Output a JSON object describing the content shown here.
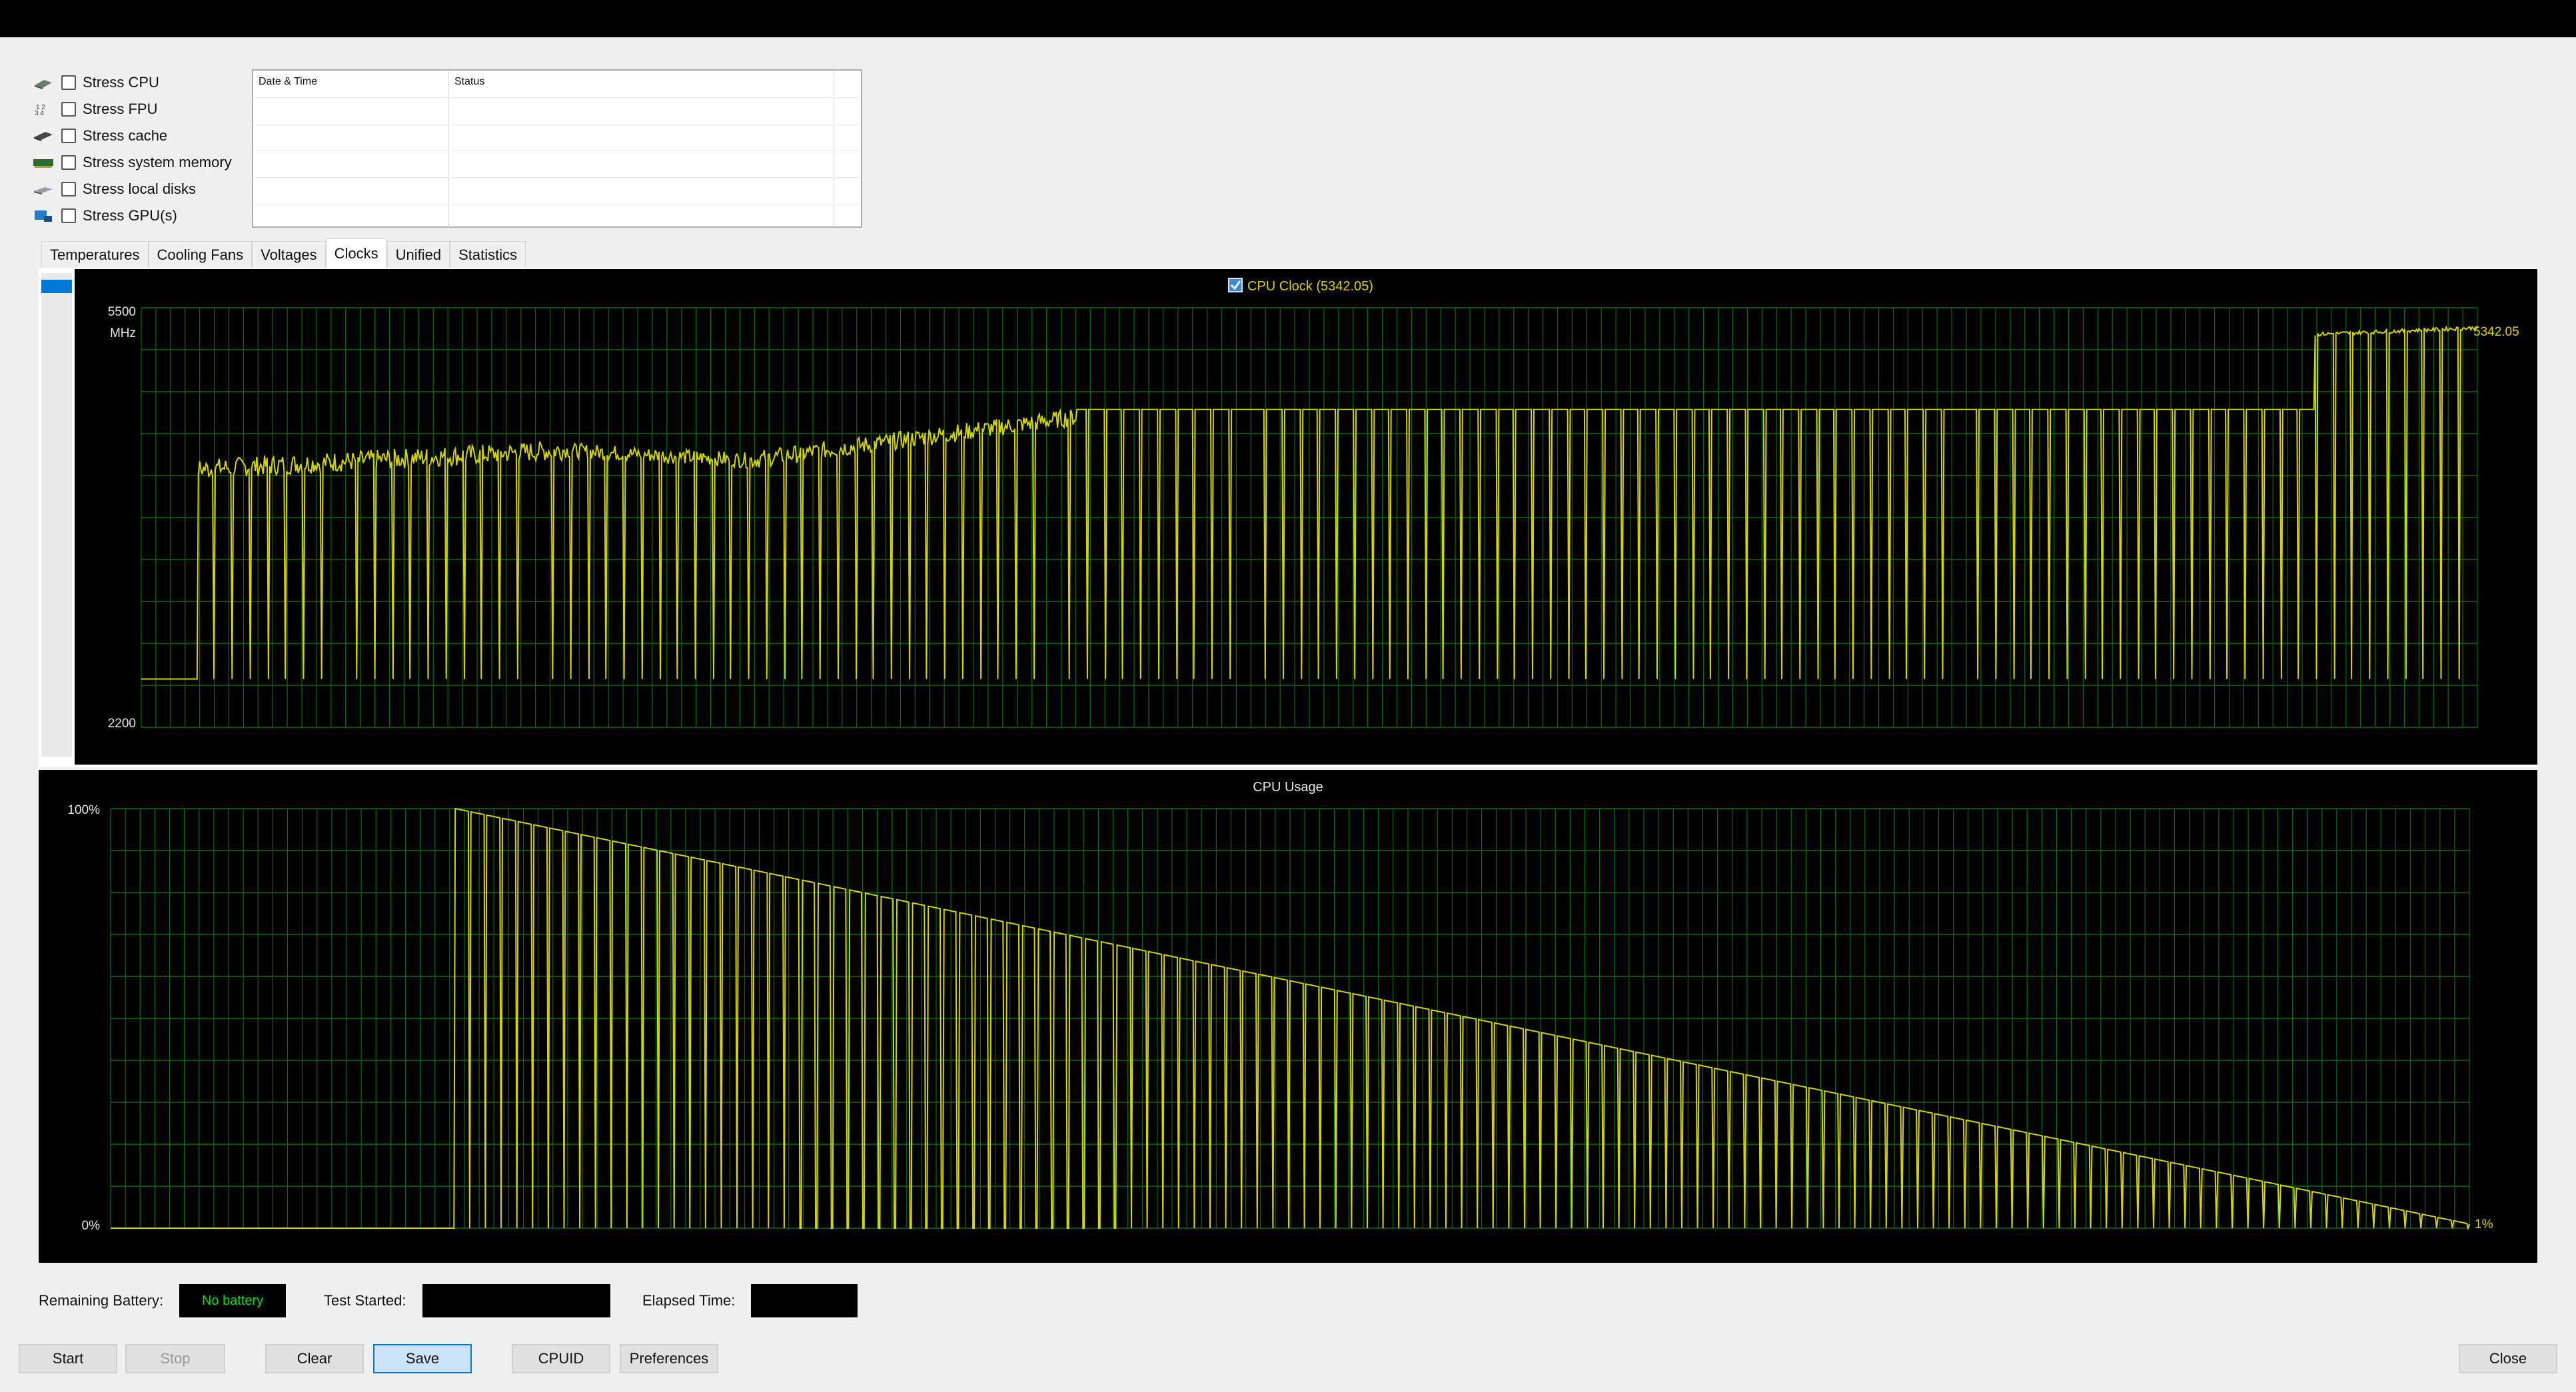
{
  "stress": {
    "items": [
      {
        "label": "Stress CPU",
        "checked": false,
        "icon": "cpu-icon"
      },
      {
        "label": "Stress FPU",
        "checked": false,
        "icon": "fpu-icon"
      },
      {
        "label": "Stress cache",
        "checked": false,
        "icon": "cache-icon"
      },
      {
        "label": "Stress system memory",
        "checked": false,
        "icon": "memory-icon"
      },
      {
        "label": "Stress local disks",
        "checked": false,
        "icon": "disk-icon"
      },
      {
        "label": "Stress GPU(s)",
        "checked": false,
        "icon": "gpu-icon"
      }
    ]
  },
  "log": {
    "col_datetime": "Date & Time",
    "col_status": "Status"
  },
  "tabs": [
    "Temperatures",
    "Cooling Fans",
    "Voltages",
    "Clocks",
    "Unified",
    "Statistics"
  ],
  "active_tab": "Clocks",
  "colors": {
    "trace": "#d4d400",
    "grid": "#0f6b0f",
    "label": "#e6e6e6",
    "value": "#e0d000"
  },
  "chart_data": [
    {
      "type": "line",
      "title": "CPU Clock (5342.05)",
      "legend_checked": true,
      "ylim": [
        2200,
        5500
      ],
      "ymax_label": "5500",
      "ymin_label": "2200",
      "unit": "MHz",
      "current_value_label": "5342.05",
      "grid": true,
      "series": [
        {
          "name": "CPU Clock",
          "segments": [
            {
              "start": 0,
              "end": 0.024,
              "from": 2580,
              "to": 2580,
              "noise": 0
            },
            {
              "start": 0.024,
              "end": 0.18,
              "from": 4230,
              "to": 4380,
              "noise": 80
            },
            {
              "start": 0.18,
              "end": 0.26,
              "from": 4380,
              "to": 4300,
              "noise": 60
            },
            {
              "start": 0.26,
              "end": 0.4,
              "from": 4300,
              "to": 4640,
              "noise": 70
            },
            {
              "start": 0.4,
              "end": 0.93,
              "from": 4700,
              "to": 4700,
              "noise": 0
            },
            {
              "start": 0.93,
              "end": 1.0,
              "from": 5290,
              "to": 5342,
              "noise": 15
            }
          ],
          "dip_value": 2580,
          "dip_count": 128
        }
      ]
    },
    {
      "type": "line",
      "title": "CPU Usage",
      "ylim": [
        0,
        100
      ],
      "ymax_label": "100%",
      "ymin_label": "0%",
      "current_value_label": "1%",
      "grid": true,
      "series": [
        {
          "name": "CPU Usage",
          "start_x": 0.146,
          "from": 100,
          "to": 1,
          "dip_value": 0,
          "dip_count": 128
        }
      ]
    }
  ],
  "status": {
    "battery_label": "Remaining Battery:",
    "battery_value": "No battery",
    "started_label": "Test Started:",
    "started_value": "",
    "elapsed_label": "Elapsed Time:",
    "elapsed_value": ""
  },
  "buttons": {
    "start": "Start",
    "stop": "Stop",
    "clear": "Clear",
    "save": "Save",
    "cpuid": "CPUID",
    "preferences": "Preferences",
    "close": "Close"
  }
}
